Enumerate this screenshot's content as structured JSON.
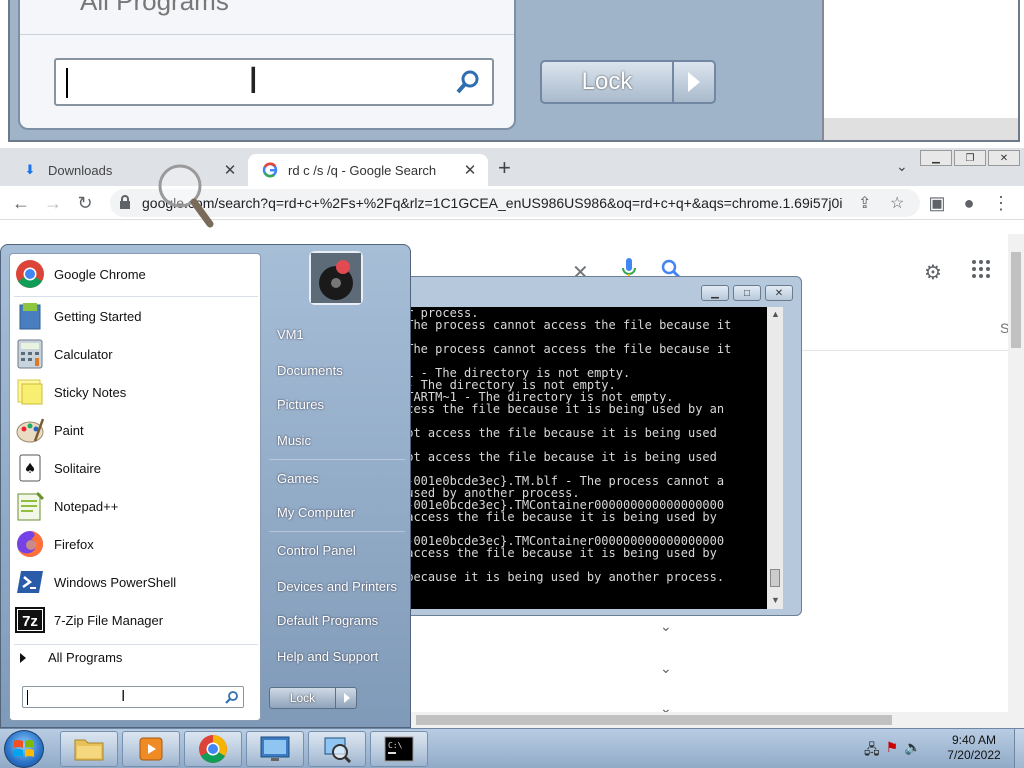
{
  "zoom": {
    "header_text": "All Programs",
    "lock_label": "Lock"
  },
  "chrome": {
    "tabs": [
      {
        "label": "Downloads",
        "icon": "download-icon"
      },
      {
        "label": "rd c /s /q - Google Search",
        "icon": "google-g-icon"
      }
    ],
    "new_tab": "+",
    "url": "google.com/search?q=rd+c+%2Fs+%2Fq&rlz=1C1GCEA_enUS986US986&oq=rd+c+q+&aqs=chrome.1.69i57j0i...",
    "side_letter": "S"
  },
  "cmd": {
    "lines": [
      "er process.",
      " The process cannot access the file because it",
      "",
      " The process cannot access the file because it",
      "",
      "~1 - The directory is not empty.",
      " - The directory is not empty.",
      "STARTM~1 - The directory is not empty.",
      "ccess the file because it is being used by an",
      "",
      "not access the file because it is being used",
      "",
      "not access the file because it is being used",
      "",
      "d-001e0bcde3ec}.TM.blf - The process cannot a",
      " used by another process.",
      "d-001e0bcde3ec}.TMContainer000000000000000000",
      " access the file because it is being used by",
      "",
      "d-001e0bcde3ec}.TMContainer000000000000000000",
      " access the file because it is being used by",
      "",
      " because it is being used by another process.",
      "",
      ""
    ]
  },
  "start_menu": {
    "programs": [
      {
        "label": "Google Chrome",
        "icon": "chrome-icon"
      },
      {
        "label": "Getting Started",
        "icon": "getting-started-icon"
      },
      {
        "label": "Calculator",
        "icon": "calculator-icon"
      },
      {
        "label": "Sticky Notes",
        "icon": "sticky-notes-icon"
      },
      {
        "label": "Paint",
        "icon": "paint-icon"
      },
      {
        "label": "Solitaire",
        "icon": "solitaire-icon"
      },
      {
        "label": "Notepad++",
        "icon": "notepadpp-icon"
      },
      {
        "label": "Firefox",
        "icon": "firefox-icon"
      },
      {
        "label": "Windows PowerShell",
        "icon": "powershell-icon"
      },
      {
        "label": "7-Zip File Manager",
        "icon": "7zip-icon"
      }
    ],
    "all_programs": "All Programs",
    "right_items": [
      "VM1",
      "Documents",
      "Pictures",
      "Music",
      "Games",
      "My Computer",
      "Control Panel",
      "Devices and Printers",
      "Default Programs",
      "Help and Support"
    ],
    "lock_label": "Lock"
  },
  "taskbar": {
    "time": "9:40 AM",
    "date": "7/20/2022"
  },
  "colors": {
    "start_blue": "#8fa8c4",
    "chrome_tabbar": "#dee1e6",
    "cmd_bg": "#000000"
  }
}
